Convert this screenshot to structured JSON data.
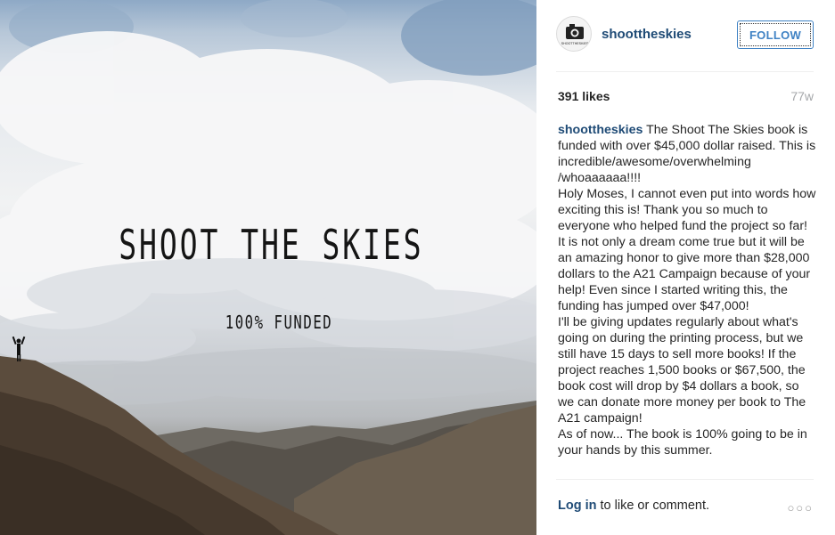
{
  "photo": {
    "title": "SHOOT THE SKIES",
    "subtitle": "100% FUNDED"
  },
  "header": {
    "avatar_text": "SHOOTTHESKIES",
    "username": "shoottheskies",
    "follow_label": "FOLLOW"
  },
  "stats": {
    "likes": "391 likes",
    "time_ago": "77w"
  },
  "caption": {
    "username": "shoottheskies",
    "lines": [
      "The Shoot The Skies book is funded with over $45,000 dollar raised. This is incredible/awesome/overwhelming /whoaaaaaa!!!!",
      "Holy Moses, I cannot even put into words how exciting this is! Thank you so much to everyone who helped fund the project so far! It is not only a dream come true but it will be an amazing honor to give more than $28,000 dollars to the A21 Campaign because of your help! Even since I started writing this, the funding has jumped over $47,000!",
      "I'll be giving updates regularly about what's going on during the printing process, but we still have 15 days to sell more books! If the project reaches 1,500 books or $67,500, the book cost will drop by $4 dollars a book, so we can donate more money per book to The A21 campaign!",
      "As of now... The book is 100% going to be in your hands by this summer."
    ]
  },
  "footer": {
    "login_label": "Log in",
    "rest_label": " to like or comment.",
    "more_icon": "ellipsis-icon",
    "more_glyph": "○○○"
  },
  "colors": {
    "link": "#1f4b76",
    "follow": "#3f82c4",
    "muted": "#a5a7aa"
  }
}
